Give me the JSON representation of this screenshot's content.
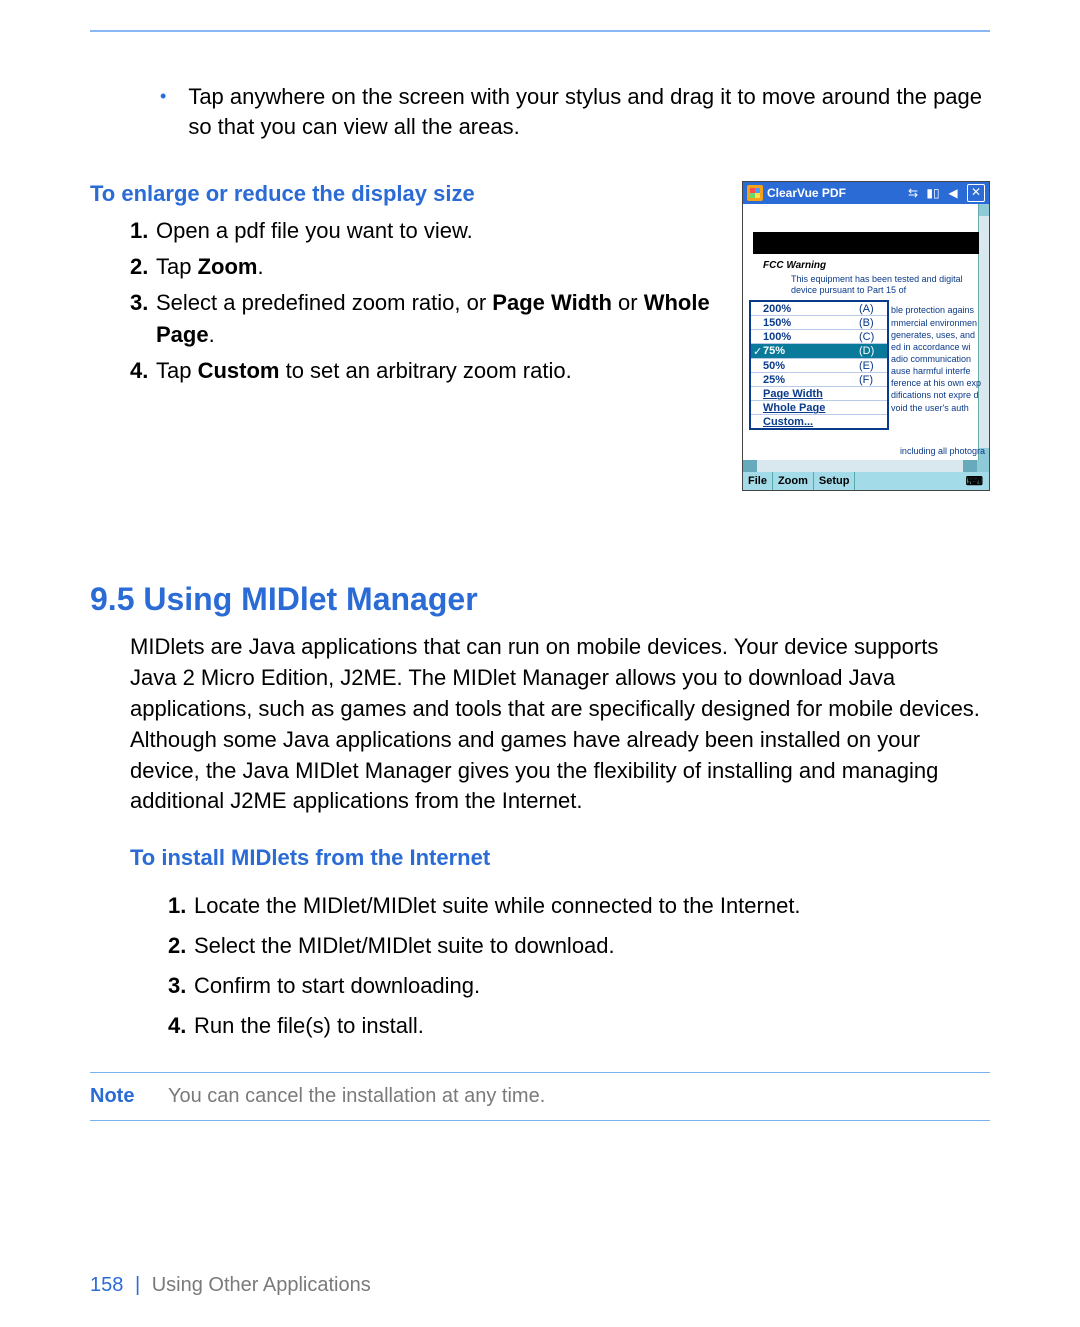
{
  "intro_bullet": "Tap anywhere on the screen with your stylus and drag it to move around the page so that you can view all the areas.",
  "display_size": {
    "heading": "To enlarge or reduce the display size",
    "items": [
      {
        "n": "1.",
        "pre": "Open a pdf file you want to view."
      },
      {
        "n": "2.",
        "pre": "Tap ",
        "b1": "Zoom",
        "post": "."
      },
      {
        "n": "3.",
        "pre": "Select a predefined zoom ratio, or ",
        "b1": "Page Width",
        "mid": " or ",
        "b2": "Whole Page",
        "post": "."
      },
      {
        "n": "4.",
        "pre": "Tap ",
        "b1": "Custom",
        "post": " to set an arbitrary zoom ratio."
      }
    ]
  },
  "device": {
    "title": "ClearVue PDF",
    "fcc": "FCC Warning",
    "para_top": "This equipment has been tested and digital device pursuant to Part 15 of",
    "para_side": "ble protection agains mmercial environmen generates, uses, and ed in accordance wi adio communication ause harmful interfe ference at his own exp difications not expre d void the user's auth",
    "inc": "including all photogra",
    "zoom_rows": [
      {
        "label": "200%",
        "key": "(A)",
        "sel": false
      },
      {
        "label": "150%",
        "key": "(B)",
        "sel": false
      },
      {
        "label": "100%",
        "key": "(C)",
        "sel": false
      },
      {
        "label": "75%",
        "key": "(D)",
        "sel": true
      },
      {
        "label": "50%",
        "key": "(E)",
        "sel": false
      },
      {
        "label": "25%",
        "key": "(F)",
        "sel": false
      }
    ],
    "zoom_extra": [
      "Page Width",
      "Whole Page",
      "Custom..."
    ],
    "bottom": [
      "File",
      "Zoom",
      "Setup"
    ]
  },
  "section": {
    "title": "9.5  Using MIDlet Manager",
    "para": "MIDlets are Java applications that can run on mobile devices. Your device supports Java 2 Micro Edition, J2ME. The MIDlet Manager allows you to download Java applications, such as games and tools that are specifically designed for mobile devices. Although some Java applications and games have already been installed on your device, the Java MIDlet Manager gives you the flexibility of installing and managing additional J2ME applications from the Internet."
  },
  "install": {
    "heading": "To install MIDlets from the Internet",
    "items": [
      {
        "n": "1.",
        "t": "Locate the MIDlet/MIDlet suite while connected to the Internet."
      },
      {
        "n": "2.",
        "t": "Select the MIDlet/MIDlet suite to download."
      },
      {
        "n": "3.",
        "t": "Confirm to start downloading."
      },
      {
        "n": "4.",
        "t": "Run the file(s) to install."
      }
    ]
  },
  "note": {
    "label": "Note",
    "text": "You can cancel the installation at any time."
  },
  "footer": {
    "page": "158",
    "title": "Using Other Applications"
  }
}
